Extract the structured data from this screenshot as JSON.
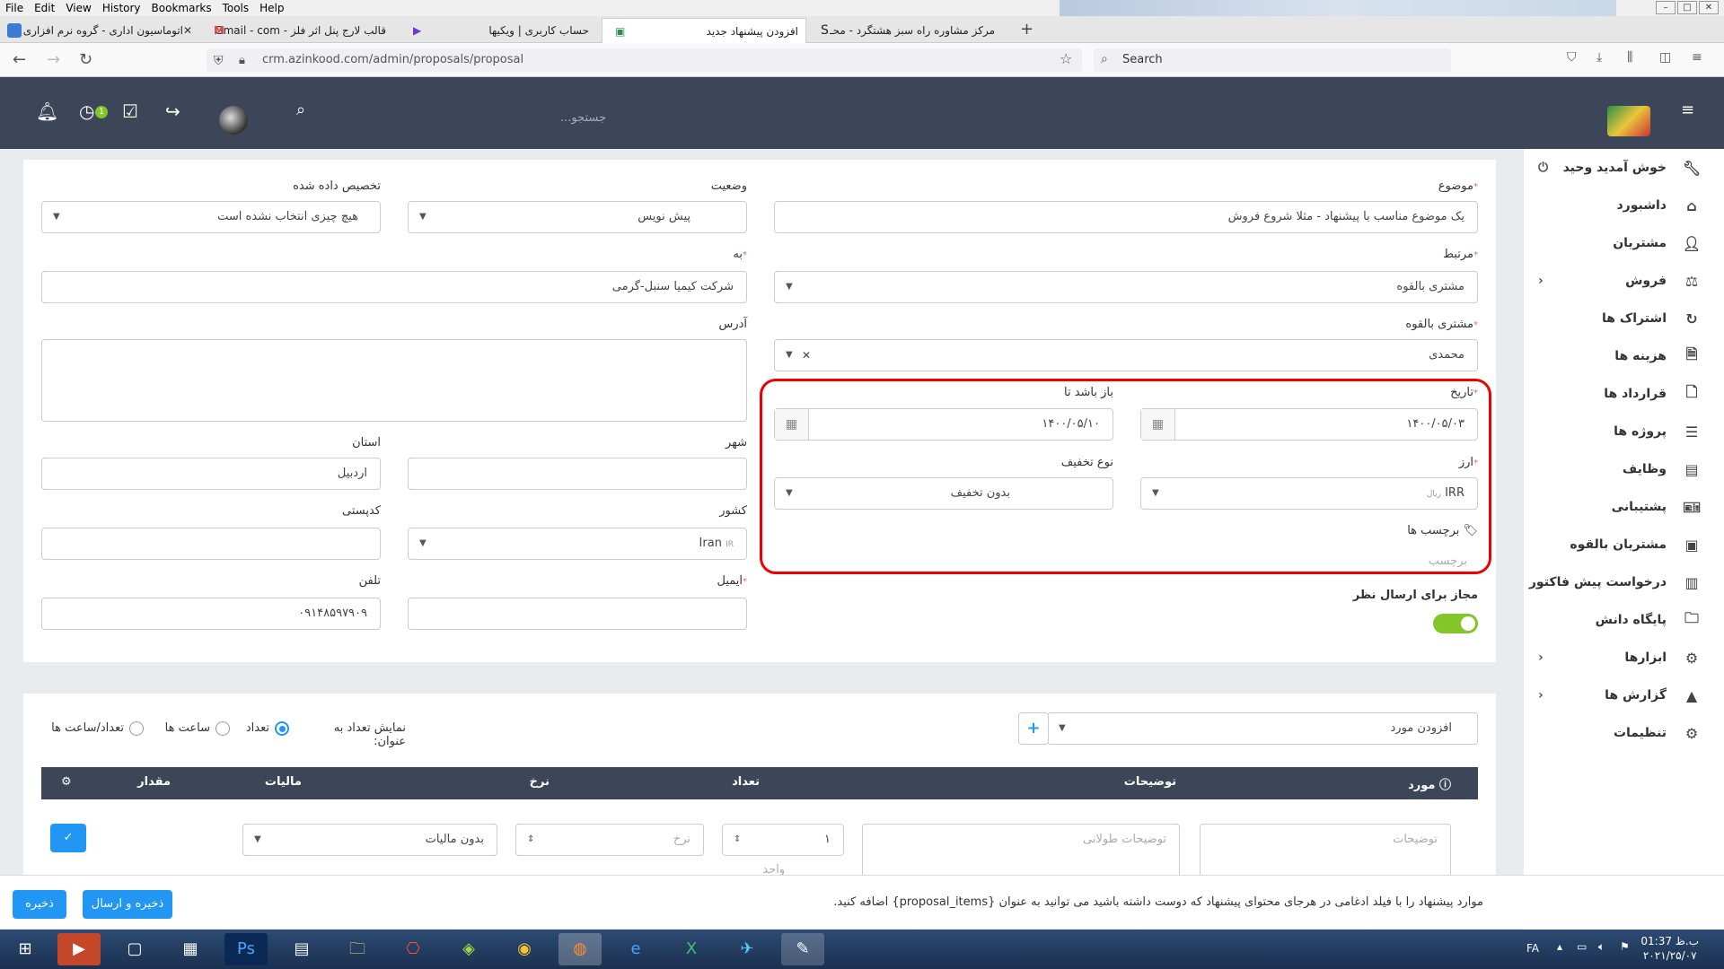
{
  "menubar": {
    "items": [
      "File",
      "Edit",
      "View",
      "History",
      "Bookmarks",
      "Tools",
      "Help"
    ]
  },
  "tabs": [
    {
      "title": "اتوماسیون اداری - گروه نرم افزاری"
    },
    {
      "title": "قالب لارج پنل اثر فلز - Gmail - com"
    },
    {
      "title": "حساب کاربری | ویکیها"
    },
    {
      "title": "افزودن پیشنهاد جدید"
    },
    {
      "title": "مرکز مشاوره راه سبز هشتگرد - محـ"
    }
  ],
  "url": "crm.azinkood.com/admin/proposals/proposal",
  "browser_search": "Search",
  "header": {
    "search_placeholder": "جستجو...",
    "notif_badge": "1"
  },
  "sidebar": {
    "items": [
      {
        "label": "خوش آمدید وحید",
        "icon": "wrench-icon"
      },
      {
        "label": "داشبورد",
        "icon": "home-icon"
      },
      {
        "label": "مشتریان",
        "icon": "user-icon"
      },
      {
        "label": "فروش",
        "icon": "scale-icon"
      },
      {
        "label": "اشتراک ها",
        "icon": "refresh-icon"
      },
      {
        "label": "هزینه ها",
        "icon": "file-icon"
      },
      {
        "label": "قرارداد ها",
        "icon": "document-icon"
      },
      {
        "label": "پروژه ها",
        "icon": "bars-icon"
      },
      {
        "label": "وظایف",
        "icon": "tasks-icon"
      },
      {
        "label": "پشتیبانی",
        "icon": "ticket-icon"
      },
      {
        "label": "مشتریان بالقوه",
        "icon": "leads-icon"
      },
      {
        "label": "درخواست پیش فاکتور",
        "icon": "list-icon"
      },
      {
        "label": "پایگاه دانش",
        "icon": "folder-icon"
      },
      {
        "label": "ابزارها",
        "icon": "gears-icon"
      },
      {
        "label": "گزارش ها",
        "icon": "chart-icon"
      },
      {
        "label": "تنظیمات",
        "icon": "gear-icon"
      }
    ]
  },
  "form": {
    "subject_label": "موضوع",
    "subject_value": "یک موضوع مناسب با پیشنهاد - مثلا شروع فروش",
    "related_label": "مرتبط",
    "related_value": "مشتری بالقوه",
    "lead_label": "مشتری بالقوه",
    "lead_value": "محمدی",
    "date_label": "تاریخ",
    "date_value": "۱۴۰۰/۰۵/۰۳",
    "open_till_label": "باز باشد تا",
    "open_till_value": "۱۴۰۰/۰۵/۱۰",
    "currency_label": "ارز",
    "currency_value": "IRR",
    "currency_sub": "ریال",
    "discount_type_label": "نوع تخفیف",
    "discount_type_value": "بدون تخفیف",
    "tags_label": "برچسب ها",
    "tags_placeholder": "برچسب",
    "allow_comments_label": "مجاز برای ارسال نظر",
    "status_label": "وضعیت",
    "status_value": "پیش نویس",
    "assigned_label": "تخصیص داده شده",
    "assigned_value": "هیچ چیزی انتخاب نشده است",
    "to_label": "به",
    "to_value": "شرکت کیمیا سنبل-گرمی",
    "address_label": "آدرس",
    "city_label": "شهر",
    "state_label": "استان",
    "state_value": "اردبیل",
    "country_label": "کشور",
    "country_value": "Iran",
    "country_code": "IR",
    "zip_label": "کدپستی",
    "email_label": "ایمیل",
    "phone_label": "تلفن",
    "phone_value": "۰۹۱۴۸۵۹۷۹۰۹"
  },
  "items": {
    "add_item_placeholder": "افزودن مورد",
    "show_qty_label": "نمایش تعداد به عنوان:",
    "opt_qty": "تعداد",
    "opt_hours": "ساعت ها",
    "opt_qty_hours": "تعداد/ساعت ها",
    "columns": [
      "مورد",
      "توضیحات",
      "تعداد",
      "نرخ",
      "مالیات",
      "مقدار"
    ],
    "desc_placeholder": "توضیحات",
    "long_desc_placeholder": "توضیحات طولانی",
    "qty_value": "۱",
    "unit_placeholder": "واحد",
    "rate_placeholder": "نرخ",
    "tax_value": "بدون مالیات"
  },
  "footer": {
    "note": "موارد پیشنهاد را با فیلد ادغامی در هرجای محتوای پیشنهاد که دوست داشته باشید می توانید به عنوان {proposal_items} اضافه کنید.",
    "save_send": "ذخیره و ارسال",
    "save": "ذخیره"
  },
  "taskbar": {
    "lang": "FA",
    "time": "01:37 ب.ظ",
    "date": "۲۰۲۱/۲۵/۰۷"
  }
}
